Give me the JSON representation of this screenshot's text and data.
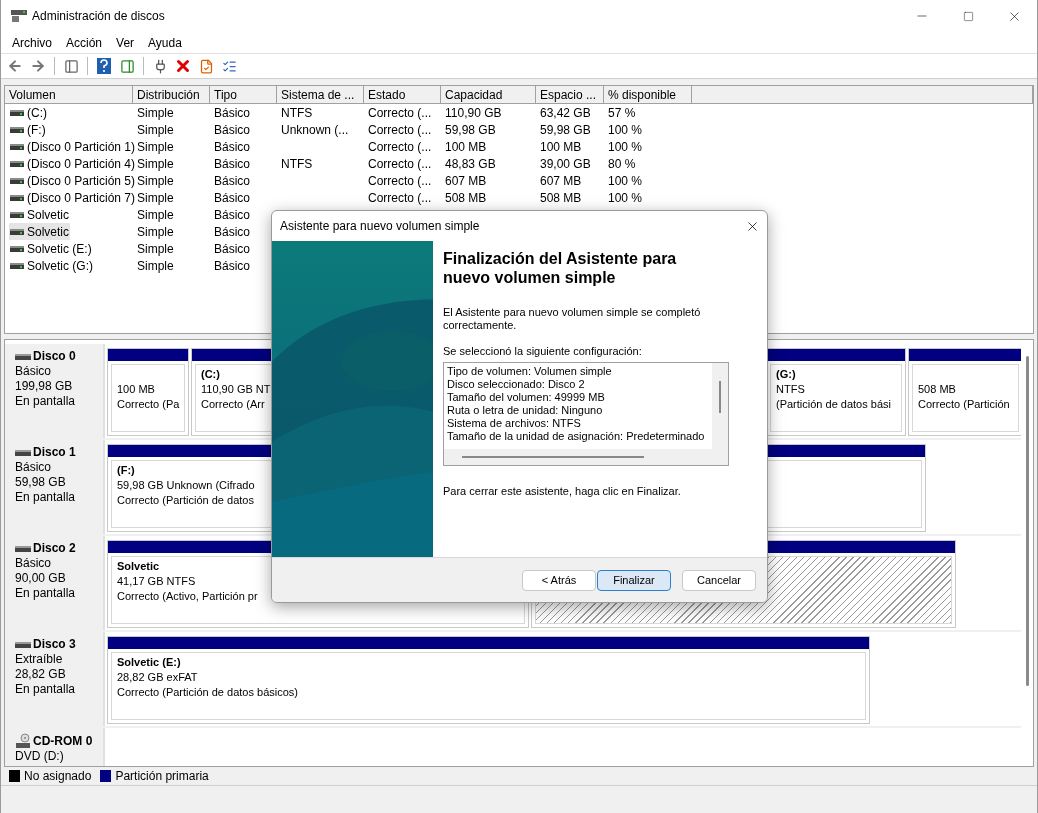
{
  "window": {
    "title": "Administración de discos"
  },
  "menu": [
    "Archivo",
    "Acción",
    "Ver",
    "Ayuda"
  ],
  "table": {
    "columns": [
      "Volumen",
      "Distribución",
      "Tipo",
      "Sistema de ...",
      "Estado",
      "Capacidad",
      "Espacio ...",
      "% disponible"
    ],
    "rows": [
      {
        "selected": false,
        "cells": [
          "(C:)",
          "Simple",
          "Básico",
          "NTFS",
          "Correcto (...",
          "110,90 GB",
          "63,42 GB",
          "57 %"
        ]
      },
      {
        "selected": false,
        "cells": [
          "(F:)",
          "Simple",
          "Básico",
          "Unknown (...",
          "Correcto (...",
          "59,98 GB",
          "59,98 GB",
          "100 %"
        ]
      },
      {
        "selected": false,
        "cells": [
          "(Disco 0 Partición 1)",
          "Simple",
          "Básico",
          null,
          "Correcto (...",
          "100 MB",
          "100 MB",
          "100 %"
        ]
      },
      {
        "selected": false,
        "cells": [
          "(Disco 0 Partición 4)",
          "Simple",
          "Básico",
          "NTFS",
          "Correcto (...",
          "48,83 GB",
          "39,00 GB",
          "80 %"
        ]
      },
      {
        "selected": false,
        "cells": [
          "(Disco 0 Partición 5)",
          "Simple",
          "Básico",
          null,
          "Correcto (...",
          "607 MB",
          "607 MB",
          "100 %"
        ]
      },
      {
        "selected": false,
        "cells": [
          "(Disco 0 Partición 7)",
          "Simple",
          "Básico",
          null,
          "Correcto (...",
          "508 MB",
          "508 MB",
          "100 %"
        ]
      },
      {
        "selected": false,
        "cells": [
          "Solvetic",
          "Simple",
          "Básico"
        ]
      },
      {
        "selected": true,
        "cells": [
          "Solvetic",
          "Simple",
          "Básico"
        ]
      },
      {
        "selected": false,
        "cells": [
          "Solvetic (E:)",
          "Simple",
          "Básico"
        ]
      },
      {
        "selected": false,
        "cells": [
          "Solvetic (G:)",
          "Simple",
          "Básico"
        ]
      }
    ]
  },
  "disks": [
    {
      "kind": "disk",
      "name": "Disco 0",
      "type": "Básico",
      "size": "199,98 GB",
      "status": "En pantalla",
      "partitions": [
        {
          "kind": "primary",
          "selected": false,
          "lines": [
            "100 MB",
            "Correcto (Pa"
          ]
        },
        {
          "kind": "primary",
          "selected": false,
          "title": "(C:)",
          "lines": [
            "110,90 GB NT",
            "Correcto (Arr"
          ]
        },
        {
          "kind": "primary",
          "selected": false,
          "title": "(G:)",
          "lines": [
            "NTFS",
            "(Partición de datos bási"
          ]
        },
        {
          "kind": "primary",
          "selected": false,
          "lines": [
            "508 MB",
            "Correcto (Partición"
          ]
        }
      ]
    },
    {
      "kind": "disk",
      "name": "Disco 1",
      "type": "Básico",
      "size": "59,98 GB",
      "status": "En pantalla",
      "partitions": [
        {
          "kind": "primary",
          "selected": false,
          "title": "(F:)",
          "lines": [
            "59,98 GB Unknown (Cifrado",
            "Correcto (Partición de datos"
          ]
        },
        {
          "kind": "primary",
          "selected": false
        }
      ]
    },
    {
      "kind": "disk",
      "name": "Disco 2",
      "type": "Básico",
      "size": "90,00 GB",
      "status": "En pantalla",
      "partitions": [
        {
          "kind": "primary",
          "selected": false,
          "title": "Solvetic",
          "lines": [
            "41,17 GB NTFS",
            "Correcto (Activo, Partición pr"
          ]
        },
        {
          "kind": "primary",
          "selected": true
        }
      ]
    },
    {
      "kind": "disk",
      "name": "Disco 3",
      "type": "Extraíble",
      "size": "28,82 GB",
      "status": "En pantalla",
      "partitions": [
        {
          "kind": "primary",
          "selected": false,
          "title": "Solvetic  (E:)",
          "lines": [
            "28,82 GB exFAT",
            "Correcto (Partición de datos básicos)"
          ]
        }
      ]
    },
    {
      "kind": "cdrom",
      "name": "CD-ROM 0",
      "type": "DVD (D:)"
    }
  ],
  "legend": [
    {
      "label": "No asignado",
      "color": "#000000"
    },
    {
      "label": "Partición primaria",
      "color": "#000080"
    }
  ],
  "dialog": {
    "title": "Asistente para nuevo volumen simple",
    "heading": "Finalización del Asistente para nuevo volumen simple",
    "intro": "El Asistente para nuevo volumen simple se completó correctamente.",
    "config_label": "Se seleccionó la siguiente configuración:",
    "config_lines": [
      "Tipo de volumen: Volumen simple",
      "Disco seleccionado: Disco 2",
      "Tamaño del volumen: 49999 MB",
      "Ruta o letra de unidad: Ninguno",
      "Sistema de archivos: NTFS",
      "Tamaño de la unidad de asignación: Predeterminado"
    ],
    "outro": "Para cerrar este asistente, haga clic en Finalizar.",
    "buttons": [
      {
        "label": "< Atrás",
        "default": false
      },
      {
        "label": "Finalizar",
        "default": true
      },
      {
        "label": "Cancelar",
        "default": false
      }
    ]
  }
}
